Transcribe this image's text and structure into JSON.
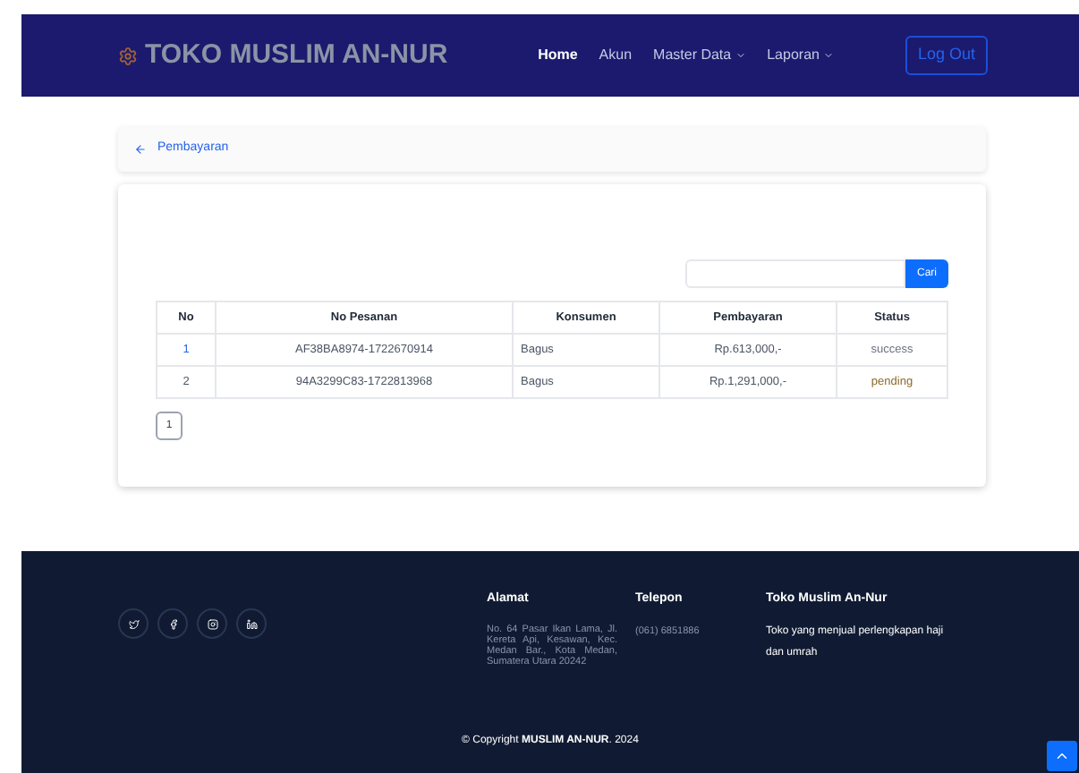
{
  "brand": "TOKO MUSLIM AN-NUR",
  "nav": [
    {
      "label": "Home",
      "selected": true,
      "dropdown": false
    },
    {
      "label": "Akun",
      "selected": false,
      "dropdown": false
    },
    {
      "label": "Master Data",
      "selected": false,
      "dropdown": true
    },
    {
      "label": "Laporan",
      "selected": false,
      "dropdown": true
    }
  ],
  "logout": "Log Out",
  "breadcrumb": "Pembayaran",
  "search": {
    "button": "Cari"
  },
  "table": {
    "columns": [
      "No",
      "No Pesanan",
      "Konsumen",
      "Pembayaran",
      "Status"
    ],
    "rows": [
      {
        "no": "1",
        "order": "AF38BA8974-1722670914",
        "customer": "Bagus",
        "payment": "Rp.613,000,-",
        "status": "success",
        "color": "#6b7280"
      },
      {
        "no": "2",
        "order": "94A3299C83-1722813968",
        "customer": "Bagus",
        "payment": "Rp.1,291,000,-",
        "status": "pending",
        "color": "#8a6a2b"
      }
    ]
  },
  "pages": [
    {
      "label": "1",
      "selected": true
    }
  ],
  "footer": {
    "address_title": "Alamat",
    "address": "No. 64 Pasar Ikan Lama, Jl. Kereta Api, Kesawan, Kec. Medan Bar., Kota Medan, Sumatera Utara 20242",
    "phone_title": "Telepon",
    "phone": "(061) 6851886",
    "about_title": "Toko Muslim An-Nur",
    "about": "Toko yang menjual perlengkapan haji dan umrah",
    "copyright": "© Copyright **MUSLIM AN-NUR**. 2024"
  }
}
